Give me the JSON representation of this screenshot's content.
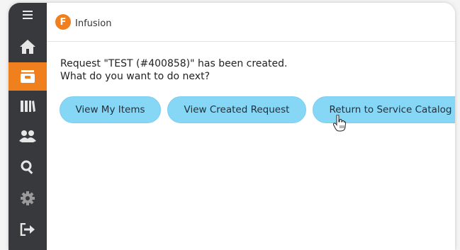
{
  "app": {
    "title": "Infusion",
    "logo_text": "F"
  },
  "sidebar": {
    "items": [
      {
        "icon": "menu-icon"
      },
      {
        "icon": "home-icon"
      },
      {
        "icon": "inbox-icon",
        "active": true
      },
      {
        "icon": "library-icon"
      },
      {
        "icon": "people-icon"
      },
      {
        "icon": "search-icon"
      },
      {
        "icon": "gear-icon"
      },
      {
        "icon": "logout-icon"
      }
    ]
  },
  "message": {
    "line1": "Request \"TEST (#400858)\" has been created.",
    "line2": "What do you want to do next?"
  },
  "actions": {
    "view_my_items": "View My Items",
    "view_created_request": "View Created Request",
    "return_to_catalog": "Return to Service Catalog"
  },
  "colors": {
    "accent": "#f07f1e",
    "sidebar": "#38393d",
    "button": "#86d7f6"
  }
}
